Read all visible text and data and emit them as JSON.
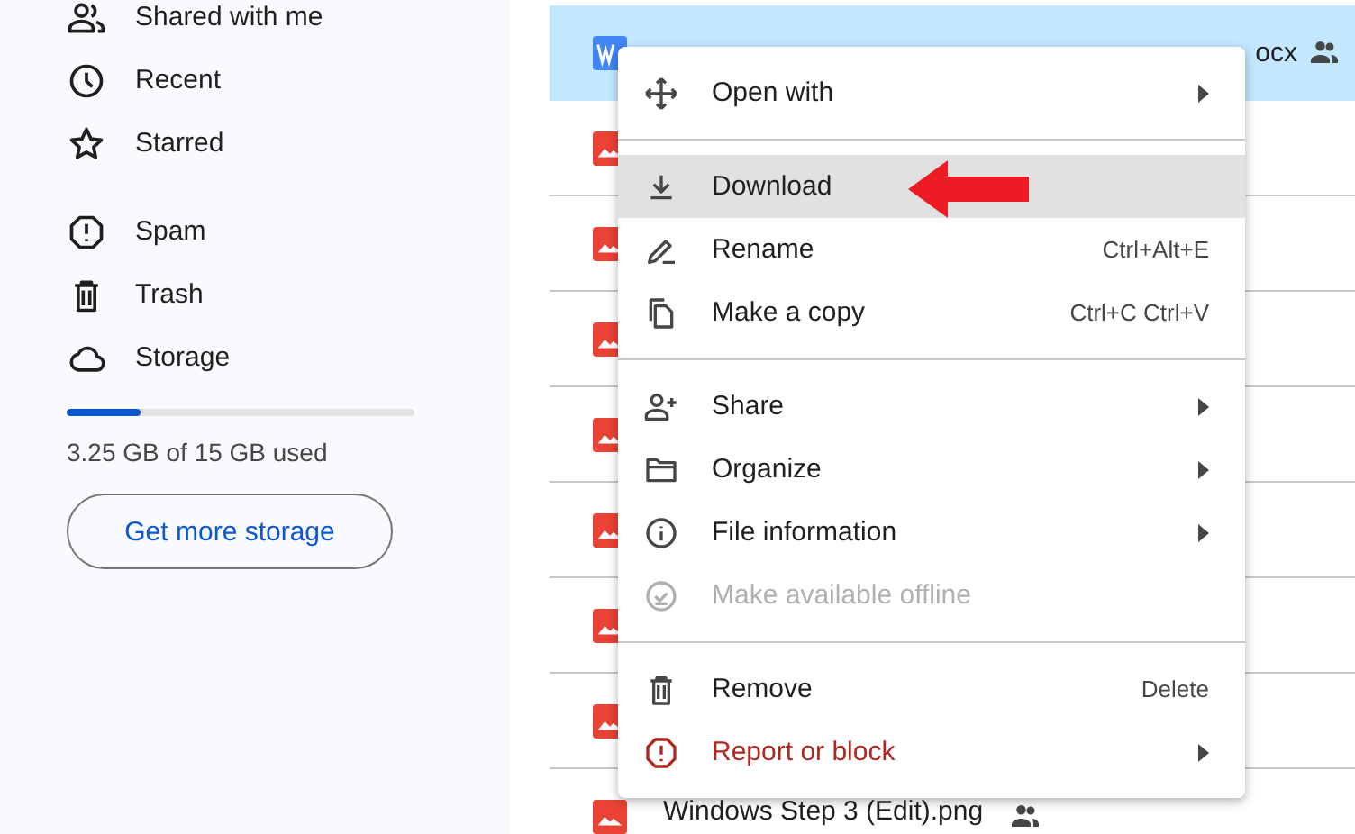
{
  "sidebar": {
    "groups": [
      [
        {
          "kind": "shared",
          "label": "Shared with me"
        },
        {
          "kind": "recent",
          "label": "Recent"
        },
        {
          "kind": "starred",
          "label": "Starred"
        }
      ],
      [
        {
          "kind": "spam",
          "label": "Spam"
        },
        {
          "kind": "trash",
          "label": "Trash"
        },
        {
          "kind": "storage",
          "label": "Storage"
        }
      ]
    ],
    "storage": {
      "level": 0.21,
      "usage": "3.25 GB of 15 GB used",
      "button": "Get more storage"
    }
  },
  "files": [
    {
      "kind": "doc",
      "name": "ocx",
      "shared": true,
      "selected": true
    },
    {
      "kind": "image",
      "selected": false
    },
    {
      "kind": "image",
      "selected": false
    },
    {
      "kind": "image",
      "selected": false
    },
    {
      "kind": "image",
      "selected": false
    },
    {
      "kind": "image",
      "selected": false
    },
    {
      "kind": "image",
      "selected": false
    },
    {
      "kind": "image",
      "selected": false
    },
    {
      "kind": "image",
      "name": "Windows Step 3 (Edit).png",
      "shared": true,
      "selected": false
    }
  ],
  "context_menu": {
    "groups": [
      [
        {
          "kind": "move",
          "label": "Open with",
          "submenu": true,
          "highlighted": false,
          "disabled": false,
          "danger": false
        }
      ],
      [
        {
          "kind": "download",
          "label": "Download",
          "submenu": false,
          "highlighted": true,
          "disabled": false,
          "danger": false
        },
        {
          "kind": "pen",
          "label": "Rename",
          "shortcut": "Ctrl+Alt+E",
          "submenu": false,
          "highlighted": false,
          "disabled": false,
          "danger": false
        },
        {
          "kind": "copy",
          "label": "Make a copy",
          "shortcut": "Ctrl+C Ctrl+V",
          "submenu": false,
          "highlighted": false,
          "disabled": false,
          "danger": false
        }
      ],
      [
        {
          "kind": "share",
          "label": "Share",
          "submenu": true,
          "highlighted": false,
          "disabled": false,
          "danger": false
        },
        {
          "kind": "folder",
          "label": "Organize",
          "submenu": true,
          "highlighted": false,
          "disabled": false,
          "danger": false
        },
        {
          "kind": "info",
          "label": "File information",
          "submenu": true,
          "highlighted": false,
          "disabled": false,
          "danger": false
        },
        {
          "kind": "offline",
          "label": "Make available offline",
          "submenu": false,
          "highlighted": false,
          "disabled": true,
          "danger": false
        }
      ],
      [
        {
          "kind": "trash",
          "label": "Remove",
          "shortcut": "Delete",
          "submenu": false,
          "highlighted": false,
          "disabled": false,
          "danger": false
        },
        {
          "kind": "report",
          "label": "Report or block",
          "submenu": true,
          "highlighted": false,
          "disabled": false,
          "danger": true
        }
      ]
    ]
  },
  "annotation": {
    "kind": "arrow"
  }
}
